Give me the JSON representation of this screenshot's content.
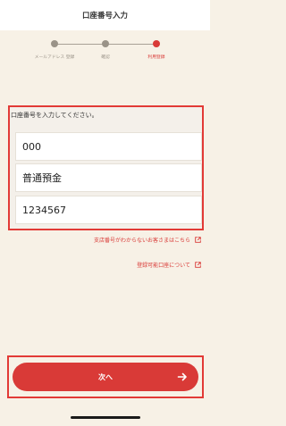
{
  "header": {
    "title": "口座番号入力"
  },
  "stepper": {
    "steps": [
      {
        "label": "メールアドレス 登録"
      },
      {
        "label": "確認"
      },
      {
        "label": "利用登録"
      }
    ],
    "active_color": "#d93a37"
  },
  "form": {
    "prompt": "口座番号を入力してください。",
    "fields": [
      {
        "value": "000"
      },
      {
        "value": "普通預金"
      },
      {
        "value": "1234567"
      }
    ]
  },
  "links": {
    "branch_unknown": "支店番号がわからないお客さまはこちら",
    "registrable_accounts": "登録可能口座について"
  },
  "next_button": {
    "label": "次へ"
  },
  "colors": {
    "accent": "#d93a37",
    "background": "#f7f1e6"
  }
}
